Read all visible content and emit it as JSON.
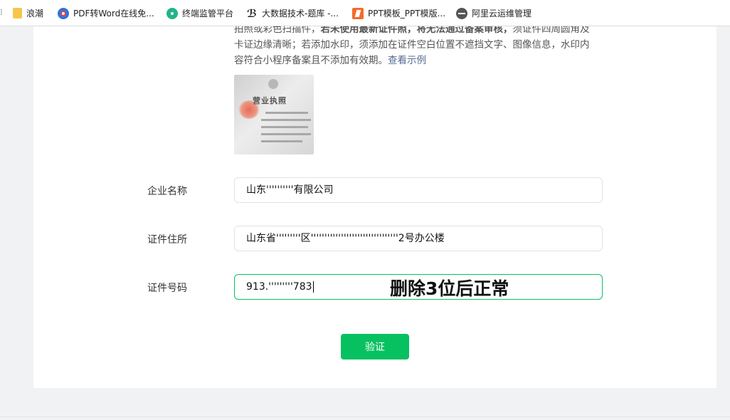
{
  "bookmarks": [
    {
      "label": "浪潮",
      "icon": "folder-icon"
    },
    {
      "label": "PDF转Word在线免...",
      "icon": "pdf-converter-icon"
    },
    {
      "label": "终端监管平台",
      "icon": "monitor-platform-icon"
    },
    {
      "label": "大数据技术-题库 -...",
      "icon": "bigdata-icon"
    },
    {
      "label": "PPT模板_PPT模版...",
      "icon": "ppt-icon"
    },
    {
      "label": "阿里云运维管理",
      "icon": "aliyun-icon"
    }
  ],
  "upload_note": {
    "line1": "拍照或彩色扫描件，",
    "line1_bold": "若未使用最新证件照，将无法通过备案审核，",
    "line1_tail": "须证件四周圆角及",
    "line2": "卡证边缘清晰；若添加水印，须添加在证件空白位置不遮挡文字、图像信息，水印内",
    "line3": "容符合小程序备案且不添加有效期。",
    "example_link": "查看示例"
  },
  "license_thumb": {
    "title": "营业执照"
  },
  "form": {
    "company_name_label": "企业名称",
    "company_name_value": "山东''''''''''有限公司",
    "address_label": "证件住所",
    "address_value": "山东省'''''''''区''''''''''''''''''''''''''''''''2号办公楼",
    "id_number_label": "证件号码",
    "id_number_value": "913.'''''''''783"
  },
  "annotation": "删除3位后正常",
  "verify_button": "验证",
  "colors": {
    "accent": "#07c160",
    "link": "#576b95"
  }
}
